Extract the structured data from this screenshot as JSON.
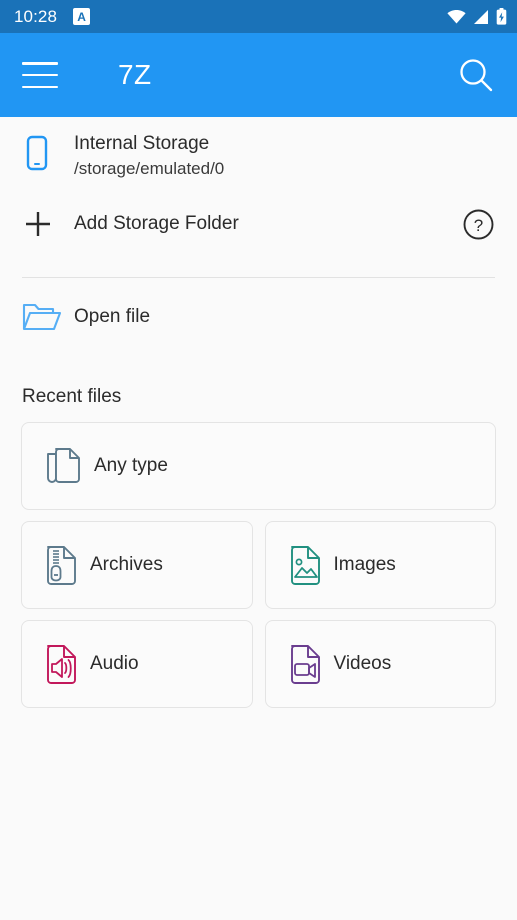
{
  "status_bar": {
    "time": "10:28",
    "notification_icon": "app-notification-icon",
    "notification_letter": "A",
    "wifi_icon": "wifi-icon",
    "signal_icon": "cellular-signal-icon",
    "battery_icon": "battery-charging-icon",
    "background_color": "#1a72b8"
  },
  "app_bar": {
    "menu_icon": "hamburger-menu-icon",
    "title": "7Z",
    "search_icon": "search-icon",
    "background_color": "#2196f3"
  },
  "storage": {
    "icon": "phone-storage-icon",
    "icon_color": "#2196f3",
    "title": "Internal Storage",
    "path": "/storage/emulated/0"
  },
  "add_storage": {
    "icon": "plus-icon",
    "label": "Add Storage Folder",
    "help_icon": "help-circle-icon"
  },
  "open_file": {
    "icon": "open-folder-icon",
    "icon_color": "#56aef5",
    "label": "Open file"
  },
  "recent": {
    "section_title": "Recent files",
    "any_type": {
      "label": "Any type",
      "icon": "copy-documents-icon",
      "color": "#5d7a8c"
    },
    "categories": [
      {
        "label": "Archives",
        "icon": "archive-zip-file-icon",
        "color": "#5d7a8c"
      },
      {
        "label": "Images",
        "icon": "image-file-icon",
        "color": "#219080"
      },
      {
        "label": "Audio",
        "icon": "audio-file-icon",
        "color": "#c2185b"
      },
      {
        "label": "Videos",
        "icon": "video-file-icon",
        "color": "#6a3d8f"
      }
    ]
  },
  "theme": {
    "primary": "#2196f3",
    "status_bar": "#1a72b8",
    "background": "#fafafa",
    "text": "#2b2b2b",
    "divider": "#e2e2e2",
    "card_border": "#e4e4e4"
  }
}
